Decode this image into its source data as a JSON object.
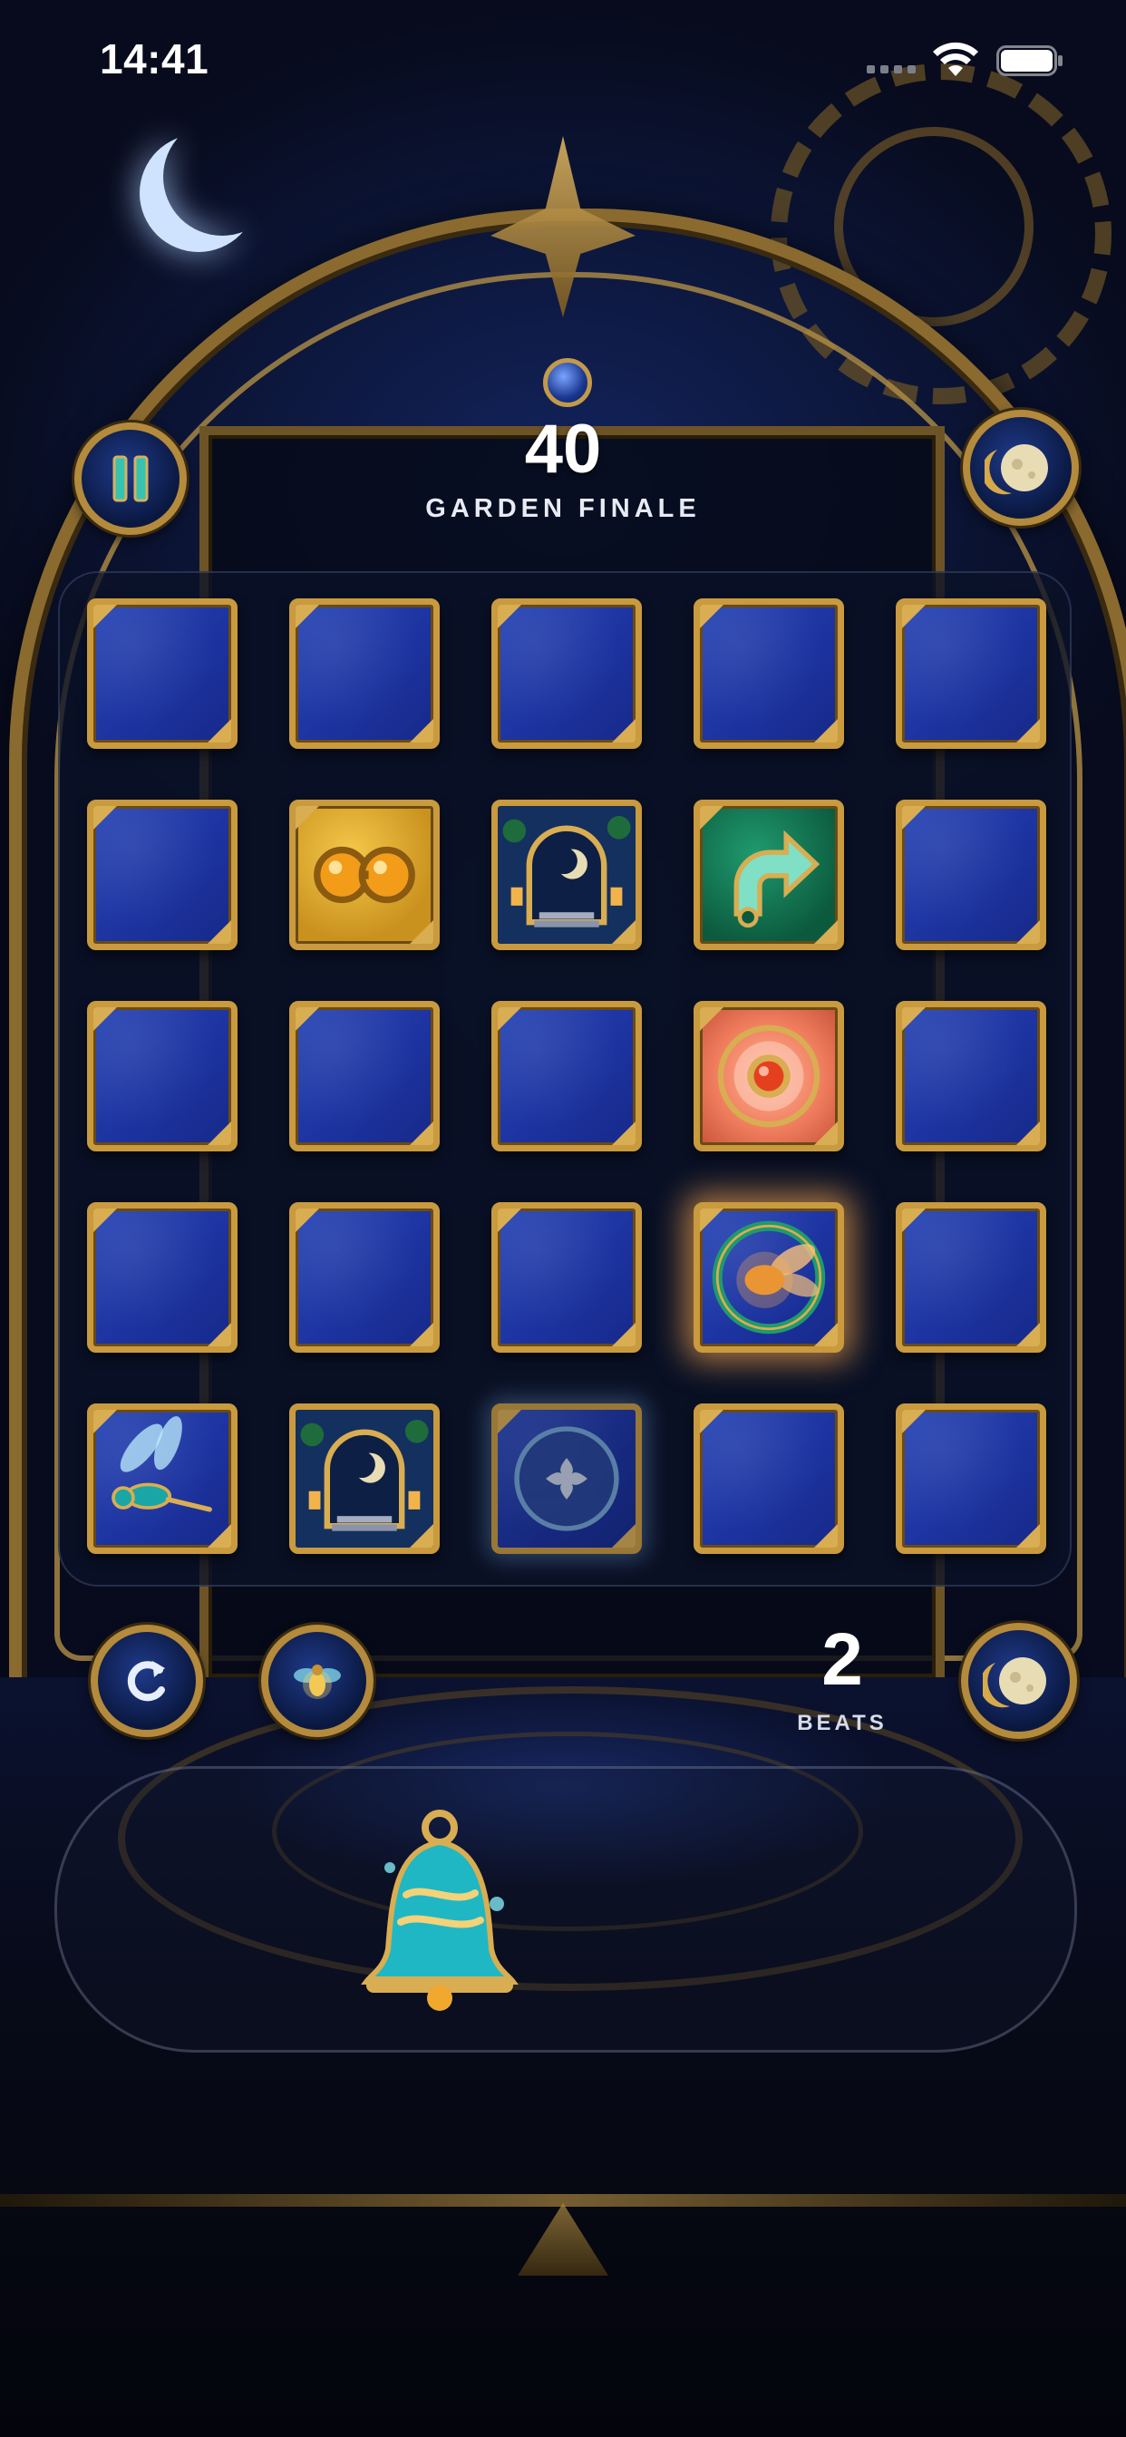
{
  "status_bar": {
    "time": "14:41"
  },
  "hud": {
    "score": "40",
    "level_name": "GARDEN FINALE",
    "beats_count": "2",
    "beats_label": "BEATS"
  },
  "icons": {
    "pause": "pause-icon",
    "moon_top": "moon-icon",
    "undo": "undo-icon",
    "hint": "firefly-hint-icon",
    "moon_bottom": "moon-icon",
    "tray_item": "bell-icon"
  },
  "board": {
    "rows": 5,
    "cols": 5,
    "tiles": [
      [
        "hidden",
        "hidden",
        "hidden",
        "hidden",
        "hidden"
      ],
      [
        "hidden",
        "goggles",
        "moon-gate",
        "arrow",
        "hidden"
      ],
      [
        "hidden",
        "hidden",
        "hidden",
        "target",
        "hidden"
      ],
      [
        "hidden",
        "hidden",
        "hidden",
        "firefly-ring",
        "hidden"
      ],
      [
        "dragonfly",
        "moon-gate",
        "flower-orb",
        "hidden",
        "hidden"
      ]
    ]
  },
  "colors": {
    "tile_blue": "#1c33a0",
    "tile_border_gold": "#c99a3e",
    "tile_gold": "#f5c84a",
    "tile_green": "#0c5a3e",
    "tile_coral": "#f07e5e",
    "text_white": "#ffffff"
  }
}
